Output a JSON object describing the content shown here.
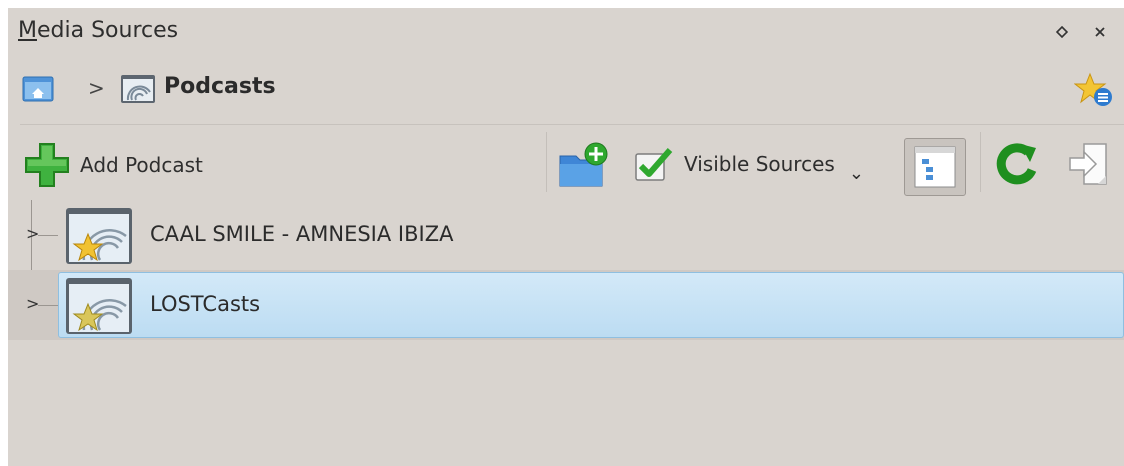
{
  "window": {
    "title_accel": "M",
    "title_rest": "edia Sources"
  },
  "breadcrumb": {
    "separator": ">",
    "current": "Podcasts"
  },
  "toolbar": {
    "add_podcast_label": "Add Podcast",
    "visible_sources_label": "Visible Sources",
    "dropdown_glyph": "⌄"
  },
  "tree": {
    "items": [
      {
        "label": "CAAL SMILE - AMNESIA IBIZA",
        "expander": ">"
      },
      {
        "label": "LOSTCasts",
        "expander": ">"
      }
    ]
  },
  "icons": {
    "float_button": "diamond-icon",
    "close_button": "close-icon",
    "home": "home-folder-icon",
    "podcast": "podcast-icon",
    "bookmark": "star-bookmark-icon",
    "add": "plus-icon",
    "new_folder": "folder-add-icon",
    "visible_sources": "checkbox-checked-icon",
    "view_mode": "view-mode-icon",
    "refresh": "refresh-icon",
    "import": "import-icon"
  },
  "colors": {
    "panel_bg": "#d9d4cf",
    "selection": "#c4e0f4",
    "accent_green": "#2fa82f"
  }
}
